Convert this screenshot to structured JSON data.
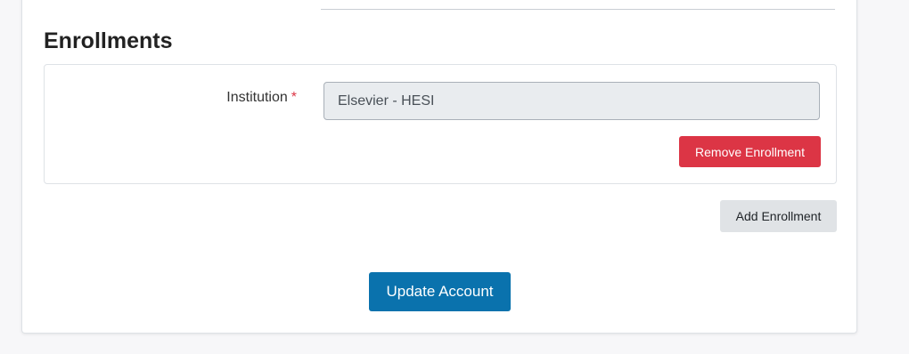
{
  "enrollments": {
    "title": "Enrollments",
    "items": [
      {
        "institution_label": "Institution",
        "required_marker": "*",
        "institution_value": "Elsevier - HESI",
        "remove_label": "Remove Enrollment"
      }
    ],
    "add_label": "Add Enrollment"
  },
  "form": {
    "submit_label": "Update Account"
  },
  "colors": {
    "danger": "#dc3545",
    "primary": "#0a72ad",
    "secondary": "#e0e3e6",
    "readonly_field": "#e9ecef"
  }
}
